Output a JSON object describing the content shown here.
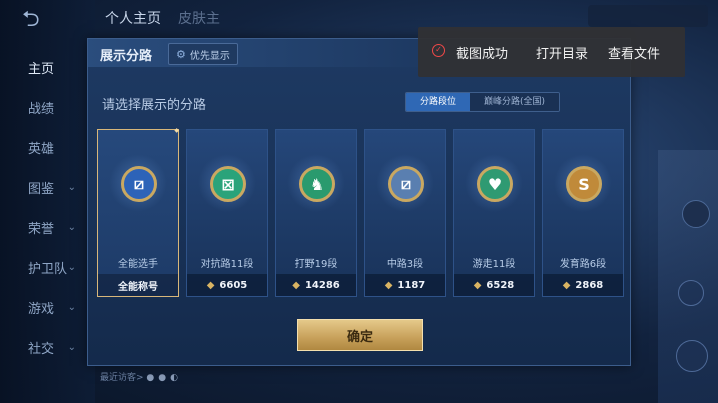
{
  "background": {
    "back_icon": "back-arrow-icon",
    "top_tabs": [
      "个人主页",
      "皮肤主"
    ],
    "nav_items": [
      {
        "label": "主页",
        "chevron": false
      },
      {
        "label": "战绩",
        "chevron": false
      },
      {
        "label": "英雄",
        "chevron": false
      },
      {
        "label": "图鉴",
        "chevron": true
      },
      {
        "label": "荣誉",
        "chevron": true
      },
      {
        "label": "护卫队",
        "chevron": true
      },
      {
        "label": "游戏",
        "chevron": true
      },
      {
        "label": "社交",
        "chevron": true
      }
    ],
    "recent_visitors": "最近访客>"
  },
  "dialog": {
    "title": "展示分路",
    "priority_label": "优先显示",
    "subtitle": "请选择展示的分路",
    "segments": [
      {
        "label": "分路段位",
        "active": true
      },
      {
        "label": "巅峰分路(全国)",
        "active": false
      }
    ],
    "cards": [
      {
        "name": "全能选手",
        "stat": "全能称号",
        "has_icon": false,
        "emblem": "⧄",
        "color": "#2d63b8",
        "selected": true
      },
      {
        "name": "对抗路11段",
        "stat": "6605",
        "has_icon": true,
        "emblem": "⊠",
        "color": "#2aa37a",
        "selected": false
      },
      {
        "name": "打野19段",
        "stat": "14286",
        "has_icon": true,
        "emblem": "♞",
        "color": "#2a9a6e",
        "selected": false
      },
      {
        "name": "中路3段",
        "stat": "1187",
        "has_icon": true,
        "emblem": "⧄",
        "color": "#5a7fb0",
        "selected": false
      },
      {
        "name": "游走11段",
        "stat": "6528",
        "has_icon": true,
        "emblem": "♥",
        "color": "#2f9a72",
        "selected": false
      },
      {
        "name": "发育路6段",
        "stat": "2868",
        "has_icon": true,
        "emblem": "S",
        "color": "#c08a3a",
        "selected": false
      }
    ],
    "confirm_label": "确定"
  },
  "toast": {
    "message": "截图成功",
    "open_dir": "打开目录",
    "view_file": "查看文件"
  }
}
